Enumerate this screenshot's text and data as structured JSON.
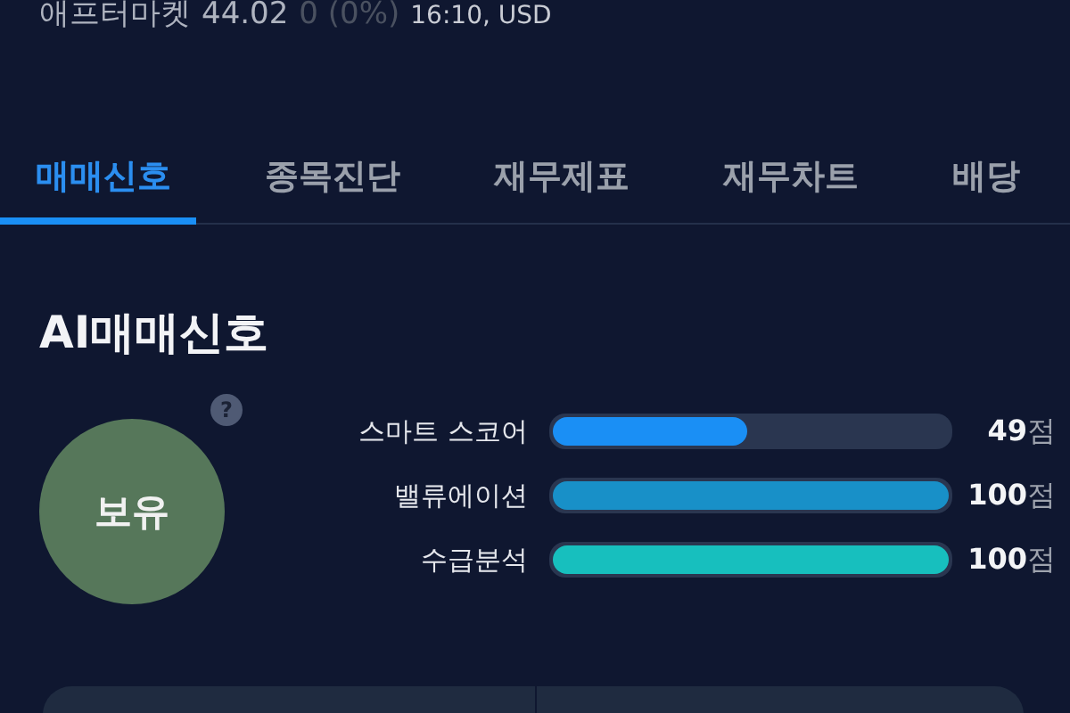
{
  "quote": {
    "label": "애프터마켓",
    "price": "44.02",
    "change": "0 (0%)",
    "time": "16:10, USD"
  },
  "tabs": [
    {
      "label": "매매신호",
      "selected": true
    },
    {
      "label": "종목진단",
      "selected": false
    },
    {
      "label": "재무제표",
      "selected": false
    },
    {
      "label": "재무차트",
      "selected": false
    },
    {
      "label": "배당",
      "selected": false
    }
  ],
  "section_title": "AI매매신호",
  "signal": {
    "label": "보유",
    "help": "?"
  },
  "scores": [
    {
      "name": "스마트 스코어",
      "level": 0.49,
      "color": "#1a8ff5",
      "value": "**49**점"
    },
    {
      "name": "밸류에이션",
      "level": 1,
      "color": "#1890c8",
      "value": "**100**점"
    },
    {
      "name": "수급분석",
      "level": 1,
      "color": "#17bfbe",
      "value": "**100**점"
    }
  ]
}
